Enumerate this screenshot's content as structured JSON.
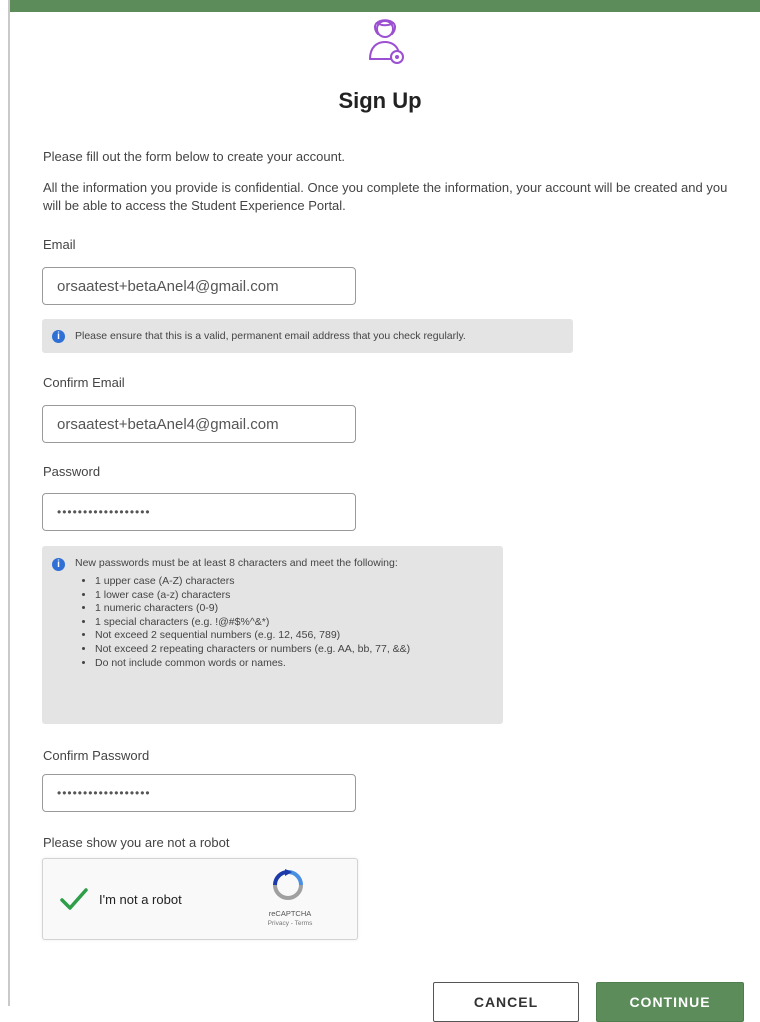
{
  "colors": {
    "accent_green": "#5b8c5a",
    "avatar_purple": "#9b4fd1",
    "info_blue": "#2f6fd6",
    "check_green": "#2e9e49"
  },
  "header": {
    "icon": "user-avatar-icon",
    "title": "Sign Up"
  },
  "intro": {
    "line1": "Please fill out the form below to create your account.",
    "line2": "All the information you provide is confidential. Once you complete the information, your account will be created and you will be able to access the Student Experience Portal."
  },
  "email": {
    "label": "Email",
    "value": "orsaatest+betaAnel4@gmail.com",
    "note": "Please ensure that this is a valid, permanent email address that you check regularly."
  },
  "confirm_email": {
    "label": "Confirm Email",
    "value": "orsaatest+betaAnel4@gmail.com"
  },
  "password": {
    "label": "Password",
    "value": "••••••••••••••••••"
  },
  "password_rules": {
    "intro": "New passwords must be at least 8 characters and meet the following:",
    "items": [
      "1 upper case (A-Z) characters",
      "1 lower case (a-z) characters",
      "1 numeric characters (0-9)",
      "1 special characters (e.g. !@#$%^&*)",
      "Not exceed 2 sequential numbers (e.g. 12, 456, 789)",
      "Not exceed 2 repeating characters or numbers (e.g. AA, bb, 77, &&)",
      "Do not include common words or names."
    ]
  },
  "confirm_password": {
    "label": "Confirm Password",
    "value": "••••••••••••••••••"
  },
  "captcha": {
    "prompt": "Please show you are not a robot",
    "label": "I'm not a robot",
    "checked": true,
    "brand": "reCAPTCHA",
    "links": "Privacy - Terms"
  },
  "actions": {
    "cancel": "CANCEL",
    "continue": "CONTINUE"
  }
}
